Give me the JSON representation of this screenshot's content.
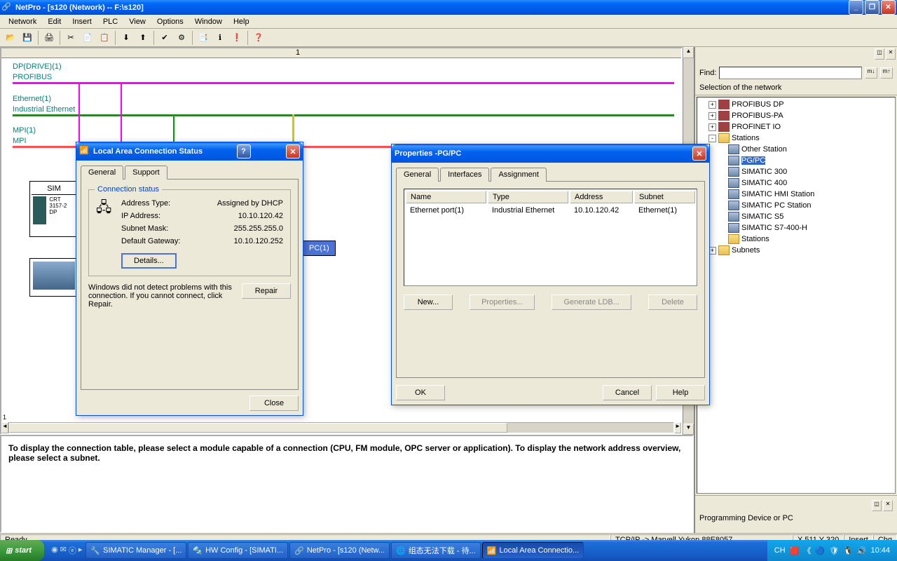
{
  "titlebar": {
    "title": "NetPro - [s120 (Network) -- F:\\s120]"
  },
  "menu": [
    "Network",
    "Edit",
    "Insert",
    "PLC",
    "View",
    "Options",
    "Window",
    "Help"
  ],
  "canvas": {
    "dp_label1": "DP(DRIVE)(1)",
    "dp_label2": "PROFIBUS",
    "eth_label1": "Ethernet(1)",
    "eth_label2": "Industrial Ethernet",
    "mpi_label1": "MPI(1)",
    "mpi_label2": "MPI",
    "station1": "SIM",
    "station1_sub": "CRT\n3157-2\nDP",
    "pc_box": "PC(1)",
    "ruler_mark": "1",
    "vmark": "1"
  },
  "hint": "To display the connection table, please select a module capable of a connection (CPU, FM module, OPC server or application). To display the network address overview, please select a subnet.",
  "right": {
    "find_label": "Find:",
    "section": "Selection of the network",
    "tree": [
      {
        "exp": "+",
        "icon": "net",
        "label": "PROFIBUS DP",
        "indent": 1
      },
      {
        "exp": "+",
        "icon": "net",
        "label": "PROFIBUS-PA",
        "indent": 1
      },
      {
        "exp": "+",
        "icon": "net",
        "label": "PROFINET IO",
        "indent": 1
      },
      {
        "exp": "-",
        "icon": "folder",
        "label": "Stations",
        "indent": 1
      },
      {
        "exp": "",
        "icon": "dev",
        "label": "Other Station",
        "indent": 2
      },
      {
        "exp": "",
        "icon": "dev",
        "label": "PG/PC",
        "indent": 2,
        "selected": true
      },
      {
        "exp": "",
        "icon": "dev",
        "label": "SIMATIC 300",
        "indent": 2
      },
      {
        "exp": "",
        "icon": "dev",
        "label": "SIMATIC 400",
        "indent": 2
      },
      {
        "exp": "",
        "icon": "dev",
        "label": "SIMATIC HMI Station",
        "indent": 2
      },
      {
        "exp": "",
        "icon": "dev",
        "label": "SIMATIC PC Station",
        "indent": 2
      },
      {
        "exp": "",
        "icon": "dev",
        "label": "SIMATIC S5",
        "indent": 2
      },
      {
        "exp": "",
        "icon": "dev",
        "label": "SIMATIC S7-400-H",
        "indent": 2
      },
      {
        "exp": "",
        "icon": "folder",
        "label": "Stations",
        "indent": 2
      },
      {
        "exp": "+",
        "icon": "folder",
        "label": "Subnets",
        "indent": 1
      }
    ],
    "desc": "Programming Device or PC"
  },
  "status": {
    "ready": "Ready",
    "tcpip": "TCP/IP -> Marvell Yukon 88E8057 ...",
    "coords": "X 511   Y 320",
    "ins": "Insert",
    "chg": "Chg"
  },
  "dlg_conn": {
    "title": "Local Area Connection Status",
    "tab_general": "General",
    "tab_support": "Support",
    "group": "Connection status",
    "addr_type_lbl": "Address Type:",
    "addr_type_val": "Assigned by DHCP",
    "ip_lbl": "IP Address:",
    "ip_val": "10.10.120.42",
    "mask_lbl": "Subnet Mask:",
    "mask_val": "255.255.255.0",
    "gw_lbl": "Default Gateway:",
    "gw_val": "10.10.120.252",
    "details": "Details...",
    "repair_text": "Windows did not detect problems with this connection. If you cannot connect, click Repair.",
    "repair": "Repair",
    "close": "Close"
  },
  "dlg_prop": {
    "title": "Properties -PG/PC",
    "tab_general": "General",
    "tab_interfaces": "Interfaces",
    "tab_assignment": "Assignment",
    "col_name": "Name",
    "col_type": "Type",
    "col_addr": "Address",
    "col_subnet": "Subnet",
    "row_name": "Ethernet port(1)",
    "row_type": "Industrial Ethernet",
    "row_addr": "10.10.120.42",
    "row_subnet": "Ethernet(1)",
    "new": "New...",
    "properties": "Properties...",
    "generate": "Generate LDB...",
    "delete": "Delete",
    "ok": "OK",
    "cancel": "Cancel",
    "help": "Help"
  },
  "taskbar": {
    "start": "start",
    "items": [
      "SIMATIC Manager - [...",
      "HW Config - [SIMATI...",
      "NetPro - [s120 (Netw...",
      "组态无法下载 - 待...",
      "Local Area Connectio..."
    ],
    "lang": "CH",
    "time": "10:44"
  }
}
